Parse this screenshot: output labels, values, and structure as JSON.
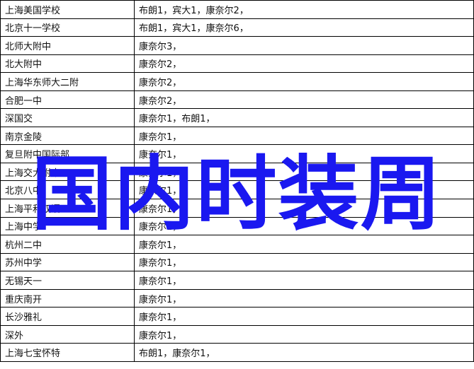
{
  "rows": [
    {
      "school": "上海美国学校",
      "admits": "布朗1，宾大1，康奈尔2，"
    },
    {
      "school": "北京十一学校",
      "admits": "布朗1，宾大1，康奈尔6，"
    },
    {
      "school": "北师大附中",
      "admits": "康奈尔3，"
    },
    {
      "school": "北大附中",
      "admits": "康奈尔2，"
    },
    {
      "school": "上海华东师大二附",
      "admits": "康奈尔2，"
    },
    {
      "school": "合肥一中",
      "admits": "康奈尔2，"
    },
    {
      "school": "深国交",
      "admits": "康奈尔1，布朗1，"
    },
    {
      "school": "南京金陵",
      "admits": "康奈尔1，"
    },
    {
      "school": "复旦附中国际部",
      "admits": "康奈尔1，"
    },
    {
      "school": "上海交大附中",
      "admits": "康奈尔1，"
    },
    {
      "school": "北京八中",
      "admits": "康奈尔1，"
    },
    {
      "school": "上海平和双语",
      "admits": "康奈尔1，"
    },
    {
      "school": "上海中学",
      "admits": "康奈尔1，"
    },
    {
      "school": "杭州二中",
      "admits": "康奈尔1，"
    },
    {
      "school": "苏州中学",
      "admits": "康奈尔1，"
    },
    {
      "school": "无锡天一",
      "admits": "康奈尔1，"
    },
    {
      "school": "重庆南开",
      "admits": "康奈尔1，"
    },
    {
      "school": "长沙雅礼",
      "admits": "康奈尔1，"
    },
    {
      "school": "深外",
      "admits": "康奈尔1，"
    },
    {
      "school": "上海七宝怀特",
      "admits": "布朗1，康奈尔1，"
    }
  ],
  "overlay": {
    "text": "国内时装周",
    "color": "#1a18f0"
  }
}
